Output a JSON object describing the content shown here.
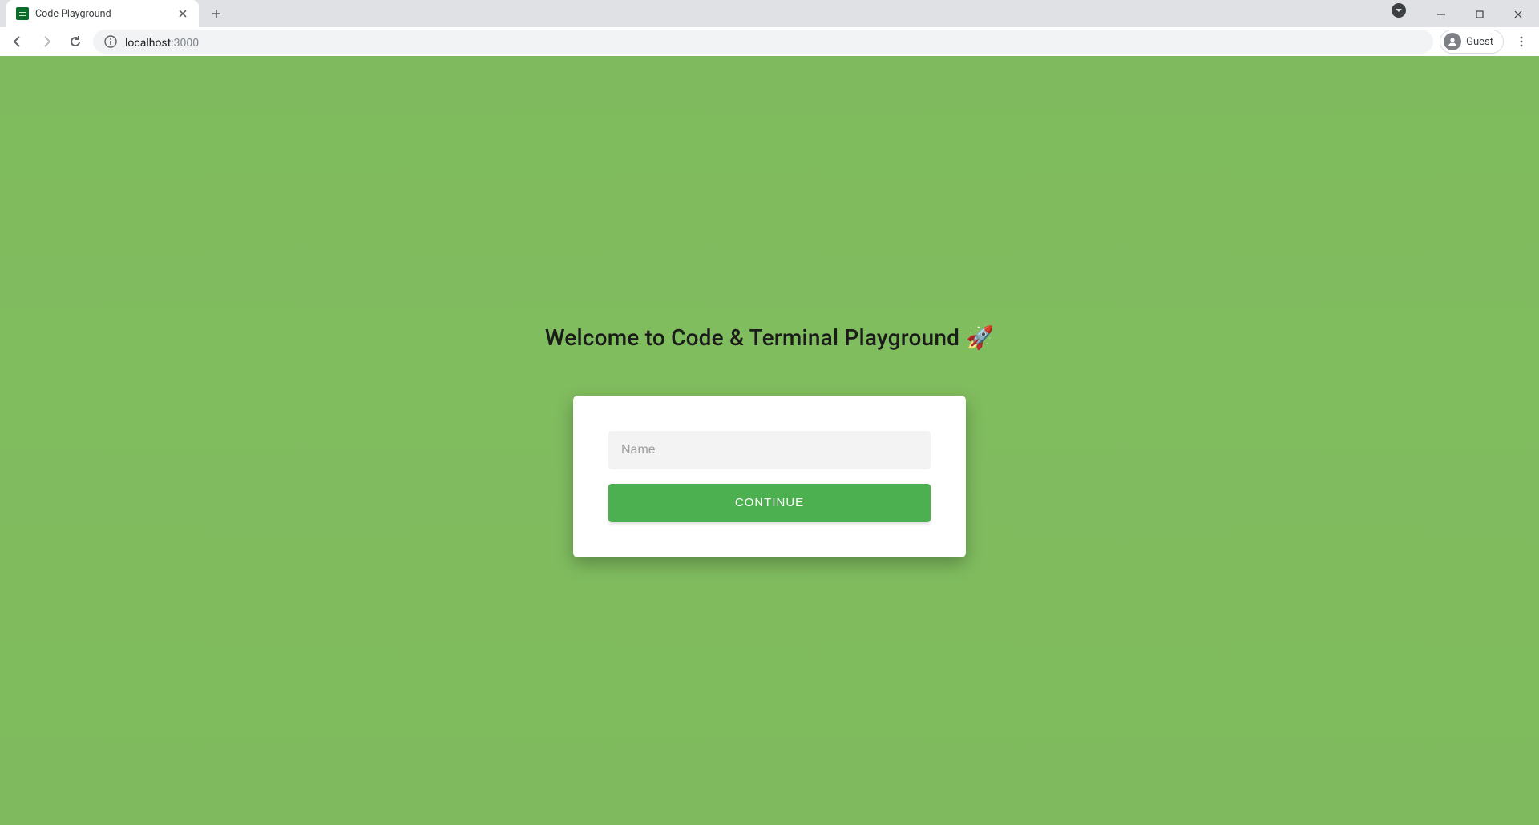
{
  "browser": {
    "tab_title": "Code Playground",
    "url_host": "localhost",
    "url_port": ":3000",
    "profile_label": "Guest"
  },
  "page": {
    "heading_text": "Welcome to Code & Terminal Playground",
    "heading_emoji": "🚀",
    "form": {
      "name_placeholder": "Name",
      "continue_label": "CONTINUE"
    }
  },
  "colors": {
    "page_bg": "#7fbb5e",
    "button_bg": "#4caf50"
  }
}
